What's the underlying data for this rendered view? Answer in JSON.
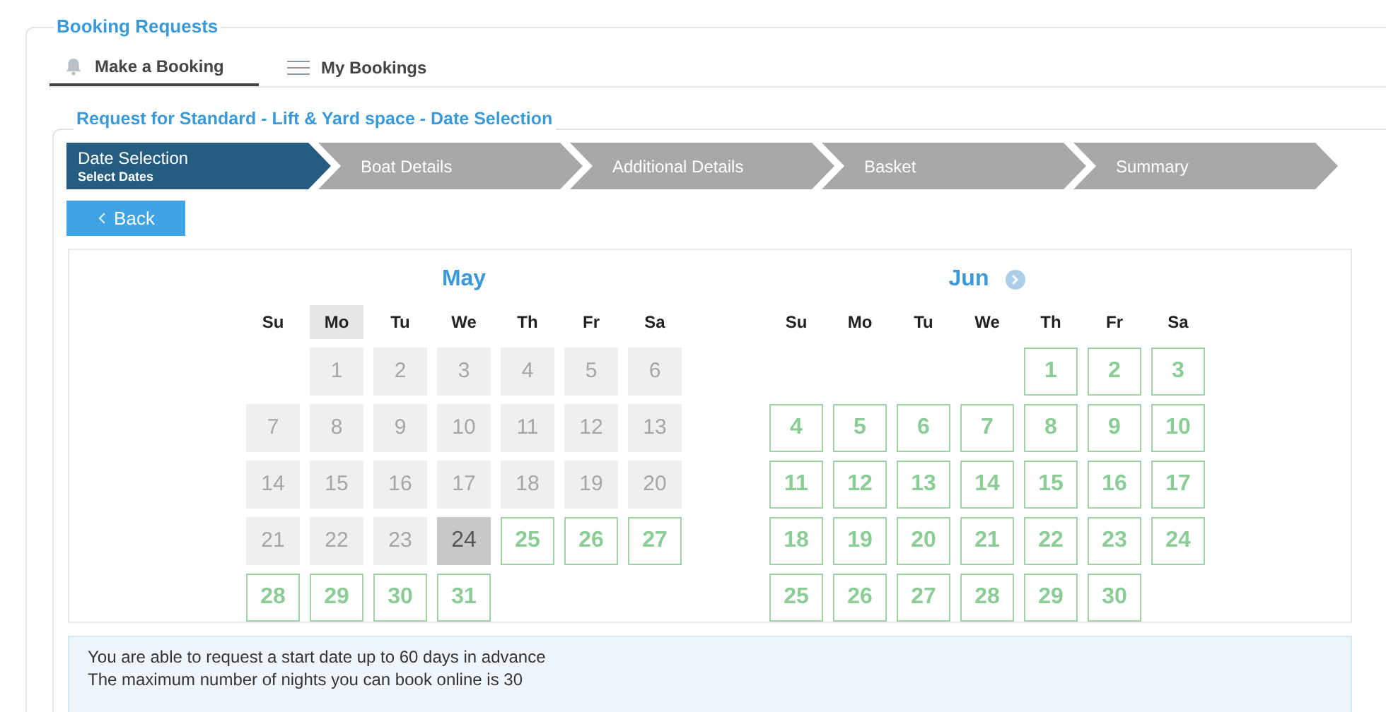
{
  "section_title": "Booking Requests",
  "tabs": [
    {
      "label": "Make a Booking",
      "selected": true
    },
    {
      "label": "My Bookings",
      "selected": false
    }
  ],
  "request_title": "Request for Standard - Lift & Yard space - Date Selection",
  "steps": [
    {
      "label": "Date Selection",
      "sublabel": "Select Dates",
      "selected": true
    },
    {
      "label": "Boat Details",
      "selected": false
    },
    {
      "label": "Additional Details",
      "selected": false
    },
    {
      "label": "Basket",
      "selected": false
    },
    {
      "label": "Summary",
      "selected": false
    }
  ],
  "back_button": "Back",
  "months": [
    {
      "name": "May",
      "weekdays": [
        {
          "label": "Su",
          "highlighted": false
        },
        {
          "label": "Mo",
          "highlighted": true
        },
        {
          "label": "Tu",
          "highlighted": false
        },
        {
          "label": "We",
          "highlighted": false
        },
        {
          "label": "Th",
          "highlighted": false
        },
        {
          "label": "Fr",
          "highlighted": false
        },
        {
          "label": "Sa",
          "highlighted": false
        }
      ],
      "days": [
        {
          "kind": "empty"
        },
        {
          "label": "1",
          "kind": "past"
        },
        {
          "label": "2",
          "kind": "past"
        },
        {
          "label": "3",
          "kind": "past"
        },
        {
          "label": "4",
          "kind": "past"
        },
        {
          "label": "5",
          "kind": "past"
        },
        {
          "label": "6",
          "kind": "past"
        },
        {
          "label": "7",
          "kind": "past"
        },
        {
          "label": "8",
          "kind": "past"
        },
        {
          "label": "9",
          "kind": "past"
        },
        {
          "label": "10",
          "kind": "past"
        },
        {
          "label": "11",
          "kind": "past"
        },
        {
          "label": "12",
          "kind": "past"
        },
        {
          "label": "13",
          "kind": "past"
        },
        {
          "label": "14",
          "kind": "past"
        },
        {
          "label": "15",
          "kind": "past"
        },
        {
          "label": "16",
          "kind": "past"
        },
        {
          "label": "17",
          "kind": "past"
        },
        {
          "label": "18",
          "kind": "past"
        },
        {
          "label": "19",
          "kind": "past"
        },
        {
          "label": "20",
          "kind": "past"
        },
        {
          "label": "21",
          "kind": "past"
        },
        {
          "label": "22",
          "kind": "past"
        },
        {
          "label": "23",
          "kind": "past"
        },
        {
          "label": "24",
          "kind": "today"
        },
        {
          "label": "25",
          "kind": "available"
        },
        {
          "label": "26",
          "kind": "available"
        },
        {
          "label": "27",
          "kind": "available"
        },
        {
          "label": "28",
          "kind": "available"
        },
        {
          "label": "29",
          "kind": "available"
        },
        {
          "label": "30",
          "kind": "available"
        },
        {
          "label": "31",
          "kind": "available"
        }
      ]
    },
    {
      "name": "Jun",
      "has_next": true,
      "weekdays": [
        {
          "label": "Su",
          "highlighted": false
        },
        {
          "label": "Mo",
          "highlighted": false
        },
        {
          "label": "Tu",
          "highlighted": false
        },
        {
          "label": "We",
          "highlighted": false
        },
        {
          "label": "Th",
          "highlighted": false
        },
        {
          "label": "Fr",
          "highlighted": false
        },
        {
          "label": "Sa",
          "highlighted": false
        }
      ],
      "days": [
        {
          "kind": "empty"
        },
        {
          "kind": "empty"
        },
        {
          "kind": "empty"
        },
        {
          "kind": "empty"
        },
        {
          "label": "1",
          "kind": "available"
        },
        {
          "label": "2",
          "kind": "available"
        },
        {
          "label": "3",
          "kind": "available"
        },
        {
          "label": "4",
          "kind": "available"
        },
        {
          "label": "5",
          "kind": "available"
        },
        {
          "label": "6",
          "kind": "available"
        },
        {
          "label": "7",
          "kind": "available"
        },
        {
          "label": "8",
          "kind": "available"
        },
        {
          "label": "9",
          "kind": "available"
        },
        {
          "label": "10",
          "kind": "available"
        },
        {
          "label": "11",
          "kind": "available"
        },
        {
          "label": "12",
          "kind": "available"
        },
        {
          "label": "13",
          "kind": "available"
        },
        {
          "label": "14",
          "kind": "available"
        },
        {
          "label": "15",
          "kind": "available"
        },
        {
          "label": "16",
          "kind": "available"
        },
        {
          "label": "17",
          "kind": "available"
        },
        {
          "label": "18",
          "kind": "available"
        },
        {
          "label": "19",
          "kind": "available"
        },
        {
          "label": "20",
          "kind": "available"
        },
        {
          "label": "21",
          "kind": "available"
        },
        {
          "label": "22",
          "kind": "available"
        },
        {
          "label": "23",
          "kind": "available"
        },
        {
          "label": "24",
          "kind": "available"
        },
        {
          "label": "25",
          "kind": "available"
        },
        {
          "label": "26",
          "kind": "available"
        },
        {
          "label": "27",
          "kind": "available"
        },
        {
          "label": "28",
          "kind": "available"
        },
        {
          "label": "29",
          "kind": "available"
        },
        {
          "label": "30",
          "kind": "available"
        }
      ]
    }
  ],
  "info": [
    "You are able to request a start date up to 60 days in advance",
    "The maximum number of nights you can book online is 30"
  ]
}
